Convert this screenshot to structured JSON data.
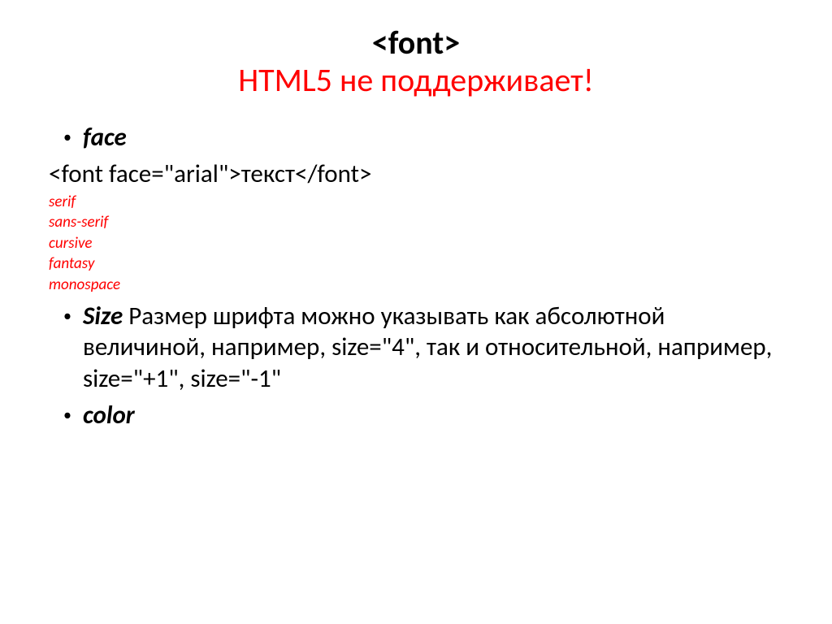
{
  "title": {
    "line1": "<font>",
    "line2": "HTML5 не поддерживает!"
  },
  "items": {
    "face": {
      "label": "face",
      "example": "<font face=\"arial\">текст</font>",
      "fontFamilies": {
        "f0": "serif",
        "f1": "sans-serif",
        "f2": "cursive",
        "f3": "fantasy",
        "f4": "monospace"
      }
    },
    "size": {
      "label": "Size",
      "description": " Размер шрифта можно указывать как абсолютной величиной, например, size=\"4\", так и относительной, например, size=\"+1\", size=\"-1\""
    },
    "color": {
      "label": "color"
    }
  }
}
